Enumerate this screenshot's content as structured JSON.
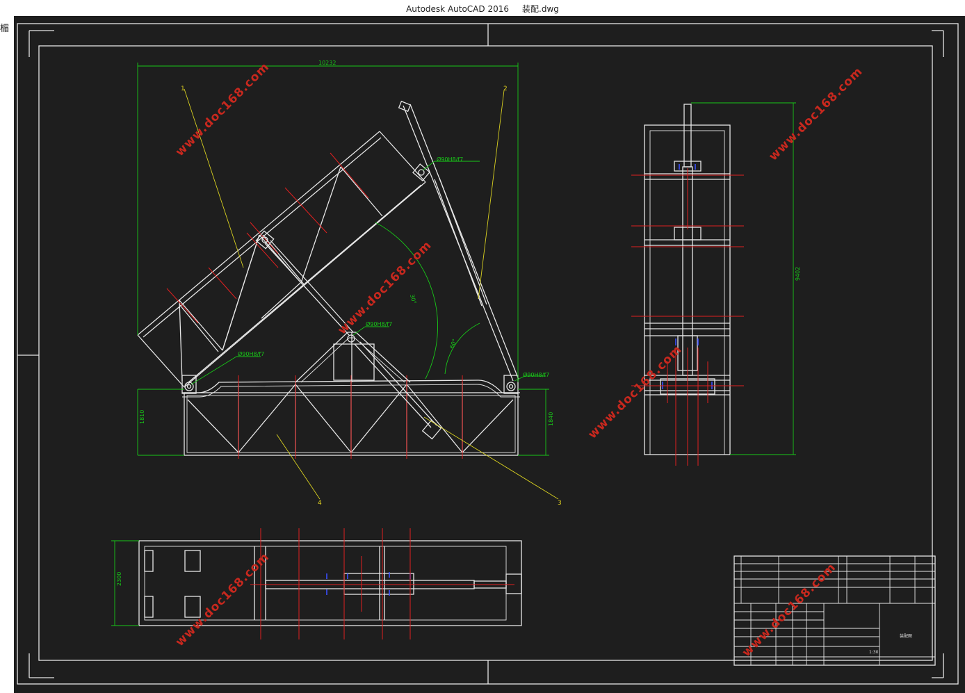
{
  "window": {
    "title": "Autodesk AutoCAD 2016     装配.dwg",
    "side_glyph": "楣"
  },
  "drawing": {
    "dimensions": {
      "overall_width": "10232",
      "left_height": "1810",
      "right_height": "1840",
      "side_height": "9402",
      "plan_width": "2300"
    },
    "angles": {
      "main": "30°",
      "cylinder": "60°"
    },
    "fits": {
      "top_hinge": "Ø90H8/f7",
      "mid_hinge": "Ø90H8/f7",
      "left_hinge": "Ø90H8/f7",
      "right_hinge": "Ø90H8/f7"
    },
    "part_labels": [
      "1",
      "2",
      "3",
      "4"
    ],
    "watermark": "www.doc168.com",
    "title_block": {
      "drawing_name": "装配图",
      "scale": "1:30"
    }
  },
  "colors": {
    "canvas_bg": "#1e1e1e",
    "geometry": "#e6e6e6",
    "centerline": "#e02020",
    "dimension": "#18c818",
    "leader": "#d8d020",
    "hidden": "#3a4dff"
  }
}
